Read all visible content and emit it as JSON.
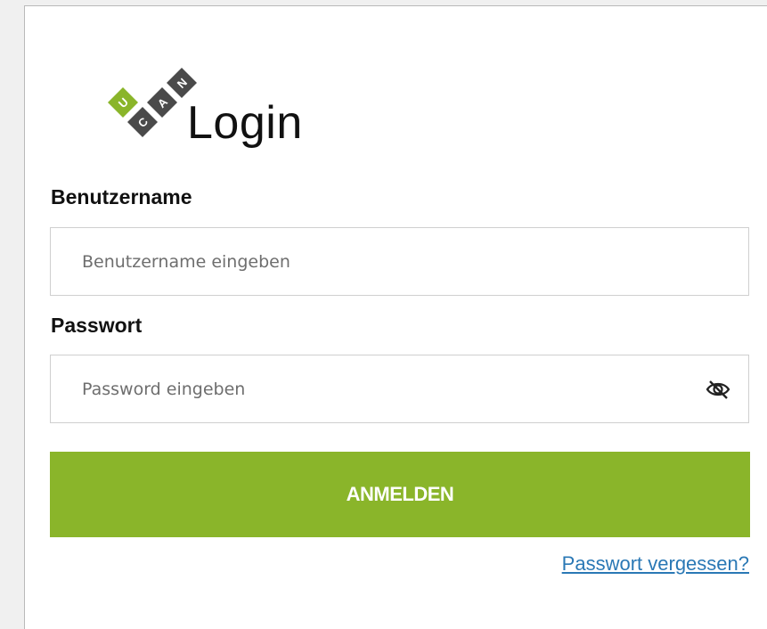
{
  "logo": {
    "letters": [
      "U",
      "C",
      "A",
      "N"
    ],
    "colors": {
      "green": "#8ab52a",
      "dark": "#4a4a4a"
    }
  },
  "title": "Login",
  "username": {
    "label": "Benutzername",
    "placeholder": "Benutzername eingeben",
    "value": ""
  },
  "password": {
    "label": "Passwort",
    "placeholder": "Password eingeben",
    "value": "",
    "toggle_icon": "eye-slash-icon"
  },
  "submit_label": "ANMELDEN",
  "forgot_link": "Passwort vergessen?",
  "colors": {
    "accent": "#8ab52a",
    "link": "#2a78b5"
  }
}
